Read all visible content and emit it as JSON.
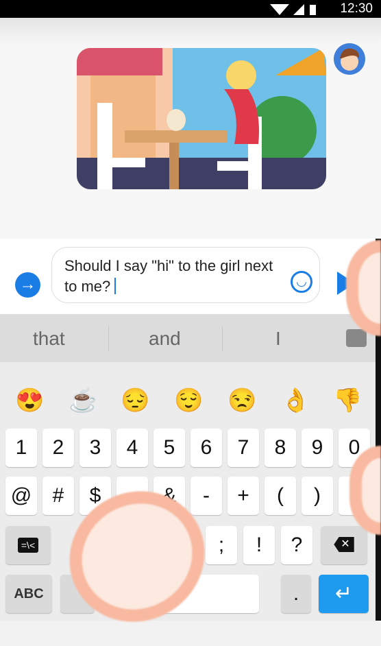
{
  "status_bar": {
    "time": "12:30"
  },
  "composer": {
    "message": "Should I say \"hi\" to the girl next to me?"
  },
  "suggestions": [
    "that",
    "and",
    "I"
  ],
  "emoji_row": [
    "😍",
    "☕",
    "😔",
    "😌",
    "😒",
    "👌",
    "👎"
  ],
  "keyboard": {
    "row1": [
      "1",
      "2",
      "3",
      "4",
      "5",
      "6",
      "7",
      "8",
      "9",
      "0"
    ],
    "row2": [
      "@",
      "#",
      "$",
      "",
      "&",
      "-",
      "+",
      "(",
      ")"
    ],
    "row3_symbols_key": "=\\<",
    "row3": [
      ";",
      "!",
      "?"
    ],
    "abc_key": "ABC",
    "period_key": ".",
    "accent_color": "#1a7de6",
    "enter_color": "#1e9bef"
  }
}
